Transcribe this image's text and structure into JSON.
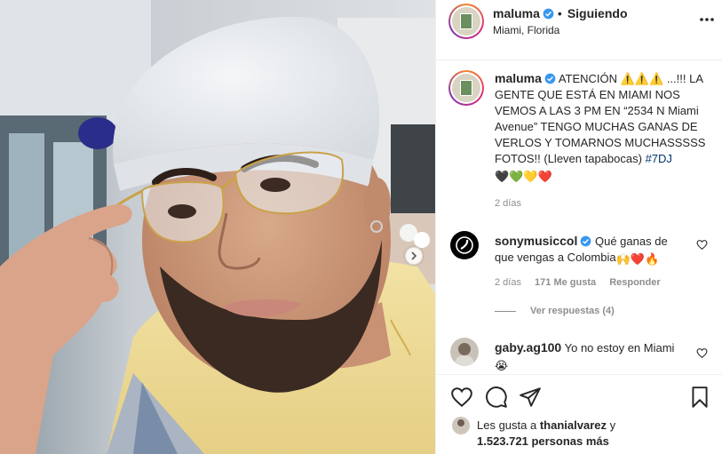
{
  "post": {
    "username": "maluma",
    "follow_status": "Siguiendo",
    "location": "Miami, Florida"
  },
  "caption": {
    "username": "maluma",
    "text": "ATENCIÓN ⚠️⚠️⚠️ ...!!! LA GENTE QUE ESTÁ EN MIAMI NOS VEMOS A LAS 3 PM EN “2534 N Miami Avenue” TENGO MUCHAS GANAS DE VERLOS Y TOMARNOS MUCHASSSSS FOTOS!! (Lleven tapabocas)",
    "hashtag": "#7DJ",
    "emojis": "🖤💚💛❤️",
    "time": "2 días"
  },
  "comments": [
    {
      "username": "sonymusiccol",
      "text": "Qué ganas de que vengas a Colombia",
      "emojis": "🙌❤️🔥",
      "time": "2 días",
      "likes": "171 Me gusta",
      "reply_label": "Responder",
      "view_replies": "Ver respuestas (4)"
    },
    {
      "username": "gaby.ag100",
      "text": "Yo no estoy en Miami",
      "emojis": "😭"
    }
  ],
  "likes": {
    "prefix": "Les gusta a",
    "first_user": "thanialvarez",
    "connector": "y",
    "count_text": "1.523.721 personas más"
  },
  "icons": {
    "verified": "verified-badge-icon",
    "more": "more-options-icon",
    "heart": "heart-icon",
    "comment": "comment-icon",
    "share": "share-icon",
    "save": "bookmark-icon",
    "carousel": "chevron-right-icon"
  },
  "colors": {
    "verified": "#3897f0",
    "hashtag": "#00376b",
    "muted": "#8e8e8e"
  }
}
